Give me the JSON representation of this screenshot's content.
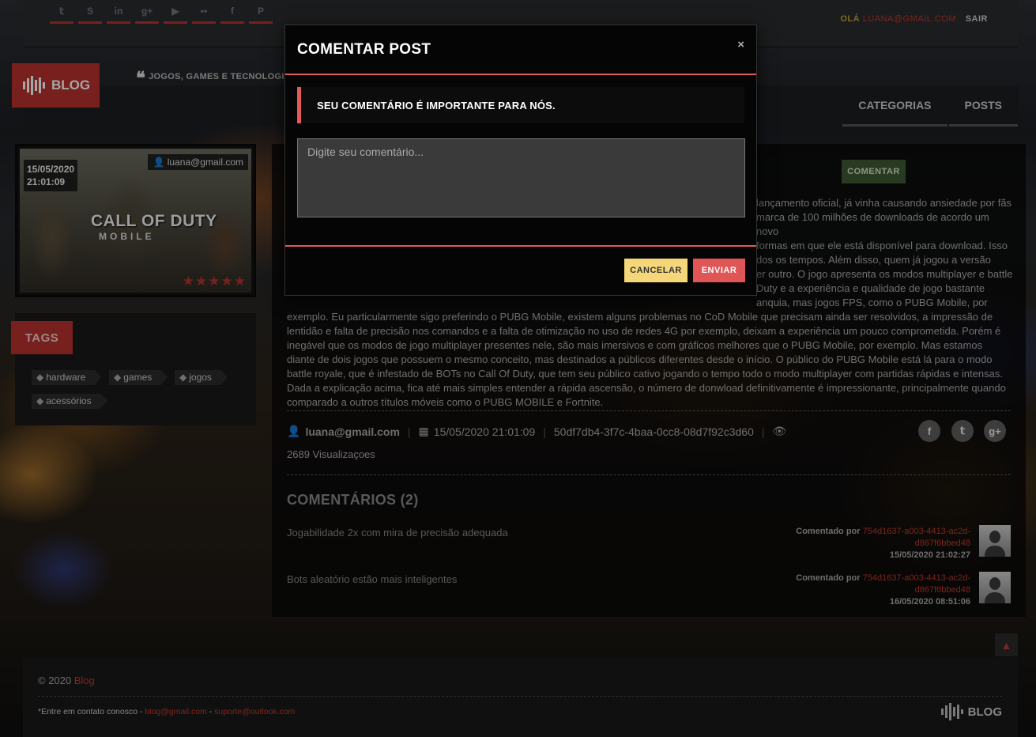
{
  "topbar": {
    "socials": [
      {
        "icon": "twitter-icon",
        "glyph": "𝕥"
      },
      {
        "icon": "skype-icon",
        "glyph": "S"
      },
      {
        "icon": "linkedin-icon",
        "glyph": "in"
      },
      {
        "icon": "google-plus-icon",
        "glyph": "g+"
      },
      {
        "icon": "youtube-icon",
        "glyph": "▶"
      },
      {
        "icon": "flickr-icon",
        "glyph": "••"
      },
      {
        "icon": "facebook-icon",
        "glyph": "f"
      },
      {
        "icon": "pinterest-icon",
        "glyph": "P"
      }
    ],
    "greeting": "OLÁ",
    "user_email": "LUANA@GMAIL.COM",
    "logout": "SAIR"
  },
  "brand": {
    "logo_text": "BLOG",
    "tagline": "JOGOS, GAMES E TECNOLOGIAS !!!"
  },
  "nav": {
    "categories": "CATEGORIAS",
    "posts": "POSTS"
  },
  "post_card": {
    "date": "15/05/2020",
    "time": "21:01:09",
    "author": "luana@gmail.com",
    "game_title": "CALL OF DUTY",
    "game_subtitle": "MOBILE",
    "rating_stars": 5
  },
  "tags": {
    "title": "TAGS",
    "items": [
      "hardware",
      "games",
      "jogos",
      "acessórios"
    ]
  },
  "post": {
    "comment_button": "COMENTAR",
    "body_visible": [
      "lançamento oficial, já vinha causando ansiedade por fãs",
      "marca de 100 milhões de downloads de acordo um novo",
      "formas em que ele está disponível para download. Isso",
      "dos os tempos. Além disso, quem já jogou a versão",
      "er outro. O jogo apresenta os modos multiplayer e battle",
      "Duty e a experiência e qualidade de jogo bastante",
      "anquia, mas jogos FPS, como o PUBG Mobile, por",
      "exemplo. Eu particularmente sigo preferindo o PUBG Mobile, existem alguns problemas no CoD Mobile que precisam ainda ser resolvidos, a impressão de",
      "lentidão e falta de precisão nos comandos e a falta de otimização no uso de redes 4G por exemplo, deixam a experiência um pouco comprometida. Porém é",
      "inegável que os modos de jogo multiplayer presentes nele, são mais imersivos e com gráficos melhores que o PUBG Mobile, por exemplo. Mas estamos",
      "diante de dois jogos que possuem o mesmo conceito, mas destinados a públicos diferentes desde o início. O público do PUBG Mobile está lá para o modo",
      "battle royale, que é infestado de BOTs no Call Of Duty, que tem seu público cativo jogando o tempo todo o modo multiplayer com partidas rápidas e intensas.",
      "Dada a explicação acima, fica até mais simples entender a rápida ascensão, o número de donwload definitivamente é impressionante, principalmente quando",
      "comparado a outros títulos móveis como o PUBG MOBILE e Fortnite."
    ],
    "author": "luana@gmail.com",
    "datetime": "15/05/2020 21:01:09",
    "post_id": "50df7db4-3f7c-4baa-0cc8-08d7f92c3d60",
    "views": "2689 Visualizaçoes",
    "comments_title": "COMENTÁRIOS (2)",
    "comments": [
      {
        "text": "Jogabilidade 2x com mira de precisão adequada",
        "by_label": "Comentado por",
        "by_id": "754d1637-a003-4413-ac2d-d867f6bbed48",
        "datetime": "15/05/2020 21:02:27"
      },
      {
        "text": "Bots aleatório estão mais inteligentes",
        "by_label": "Comentado por",
        "by_id": "754d1637-a003-4413-ac2d-d867f6bbed48",
        "datetime": "16/05/2020 08:51:06"
      }
    ]
  },
  "footer": {
    "copyright": "© 2020",
    "brand": "Blog",
    "contact_prefix": "*Entre em contato conosco -",
    "email1": "blog@gmail.com",
    "sep": "-",
    "email2": "suporte@outlook.com",
    "logo_text": "BLOG"
  },
  "modal": {
    "title": "COMENTAR POST",
    "close": "×",
    "alert": "SEU COMENTÁRIO É IMPORTANTE PARA NÓS.",
    "textarea_placeholder": "Digite seu comentário...",
    "cancel": "CANCELAR",
    "send": "ENVIAR"
  },
  "colors": {
    "accent_red": "#b8322e",
    "modal_red": "#e05a5a",
    "cancel_yellow": "#f5d77a",
    "comment_green": "#3f5a36"
  }
}
